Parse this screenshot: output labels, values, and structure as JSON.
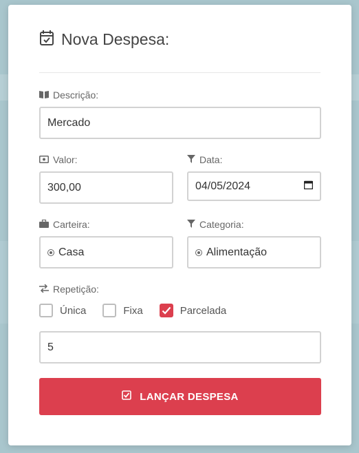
{
  "modal": {
    "title": "Nova Despesa:",
    "descricao": {
      "label": "Descrição:",
      "value": "Mercado"
    },
    "valor": {
      "label": "Valor:",
      "value": "300,00"
    },
    "data": {
      "label": "Data:",
      "value": "04/05/2024"
    },
    "carteira": {
      "label": "Carteira:",
      "value": "Casa"
    },
    "categoria": {
      "label": "Categoria:",
      "value": "Alimentação"
    },
    "repeticao": {
      "label": "Repetição:",
      "options": [
        {
          "label": "Única",
          "checked": false
        },
        {
          "label": "Fixa",
          "checked": false
        },
        {
          "label": "Parcelada",
          "checked": true
        }
      ]
    },
    "parcelas": {
      "value": "5"
    },
    "submit_label": "LANÇAR DESPESA"
  },
  "colors": {
    "accent": "#dc3f4e",
    "border": "#d2d2d2"
  }
}
